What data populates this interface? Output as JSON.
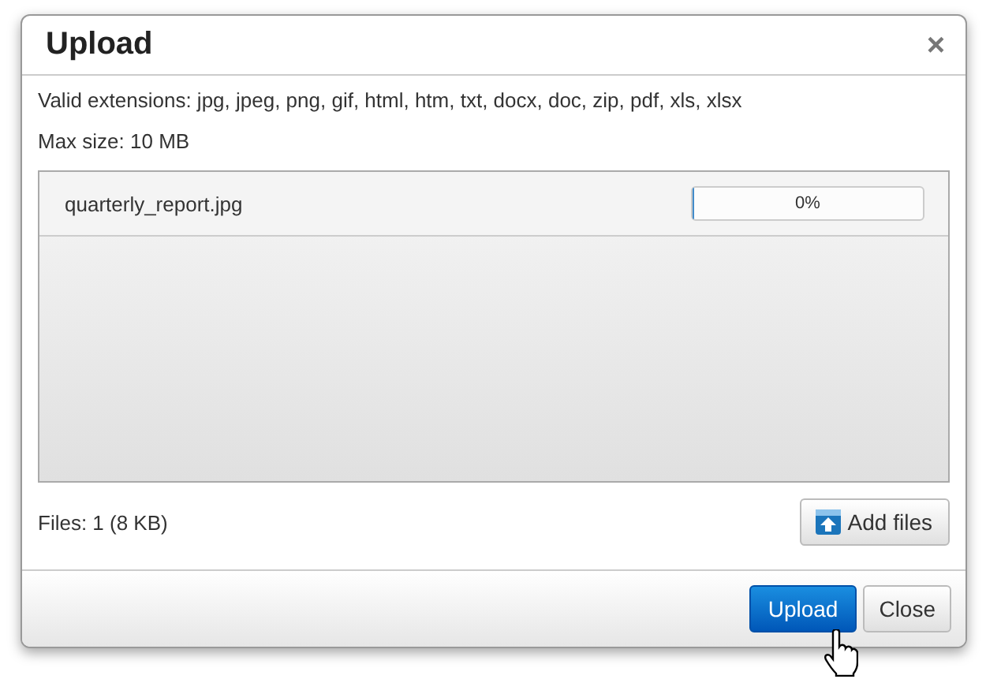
{
  "dialog": {
    "title": "Upload",
    "close_symbol": "×"
  },
  "info": [
    "Valid extensions: jpg, jpeg, png, gif, html, htm, txt, docx, doc, zip, pdf, xls, xlsx",
    "Max size: 10 MB"
  ],
  "files": [
    {
      "name": "quarterly_report.jpg",
      "level": 0,
      "reading": "0%"
    }
  ],
  "summary": "Files: 1 (8 KB)",
  "add_button": "Add files",
  "buttons": [
    {
      "label": "Upload",
      "kind": "primary"
    },
    {
      "label": "Close",
      "kind": "default"
    }
  ]
}
